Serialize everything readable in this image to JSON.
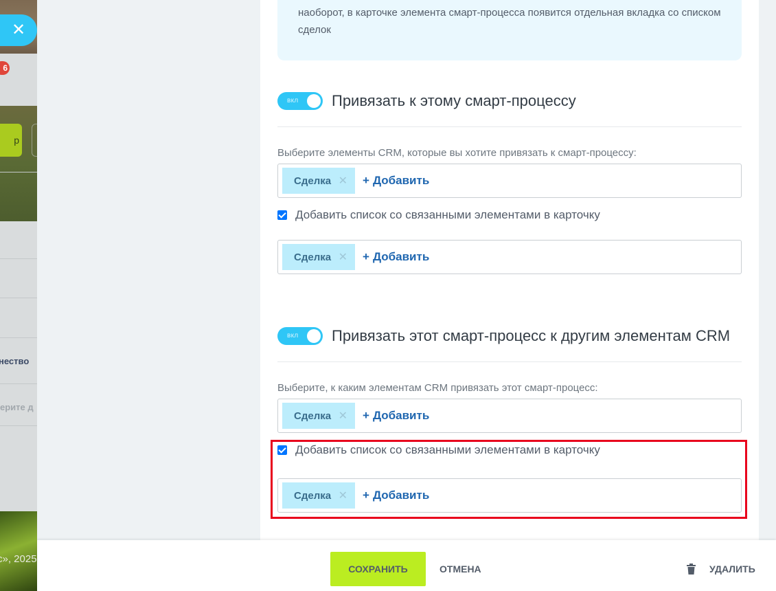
{
  "background": {
    "notification_count": "6",
    "button_fragment": "р",
    "text_fragment_1": "нество",
    "text_fragment_2": "ерите д",
    "copyright_fragment": "с», 2025"
  },
  "slider": {
    "close_icon": "close-icon",
    "info_text": "наоборот, в карточке элемента смарт-процесса появится отдельная вкладка со списком сделок",
    "section1": {
      "switch_label": "вкл",
      "title": "Привязать к этому смарт-процессу",
      "hint": "Выберите элементы CRM, которые вы хотите привязать к смарт-процессу:",
      "tag": "Сделка",
      "add_label": "Добавить",
      "checkbox_label": "Добавить список со связанными элементами в карточку",
      "tag2": "Сделка",
      "add_label2": "Добавить"
    },
    "section2": {
      "switch_label": "вкл",
      "title": "Привязать этот смарт-процесс к другим элементам CRM",
      "hint": "Выберите, к каким элементам CRM привязать этот смарт-процесс:",
      "tag": "Сделка",
      "add_label": "Добавить",
      "checkbox_label": "Добавить список со связанными элементами в карточку",
      "tag2": "Сделка",
      "add_label2": "Добавить"
    }
  },
  "footer": {
    "save_label": "СОХРАНИТЬ",
    "cancel_label": "ОТМЕНА",
    "delete_label": "УДАЛИТЬ"
  },
  "colors": {
    "accent": "#2fc6f6",
    "save": "#bbed21",
    "tag_bg": "#bcedfc",
    "link": "#2067b0",
    "highlight": "#e8001c"
  }
}
